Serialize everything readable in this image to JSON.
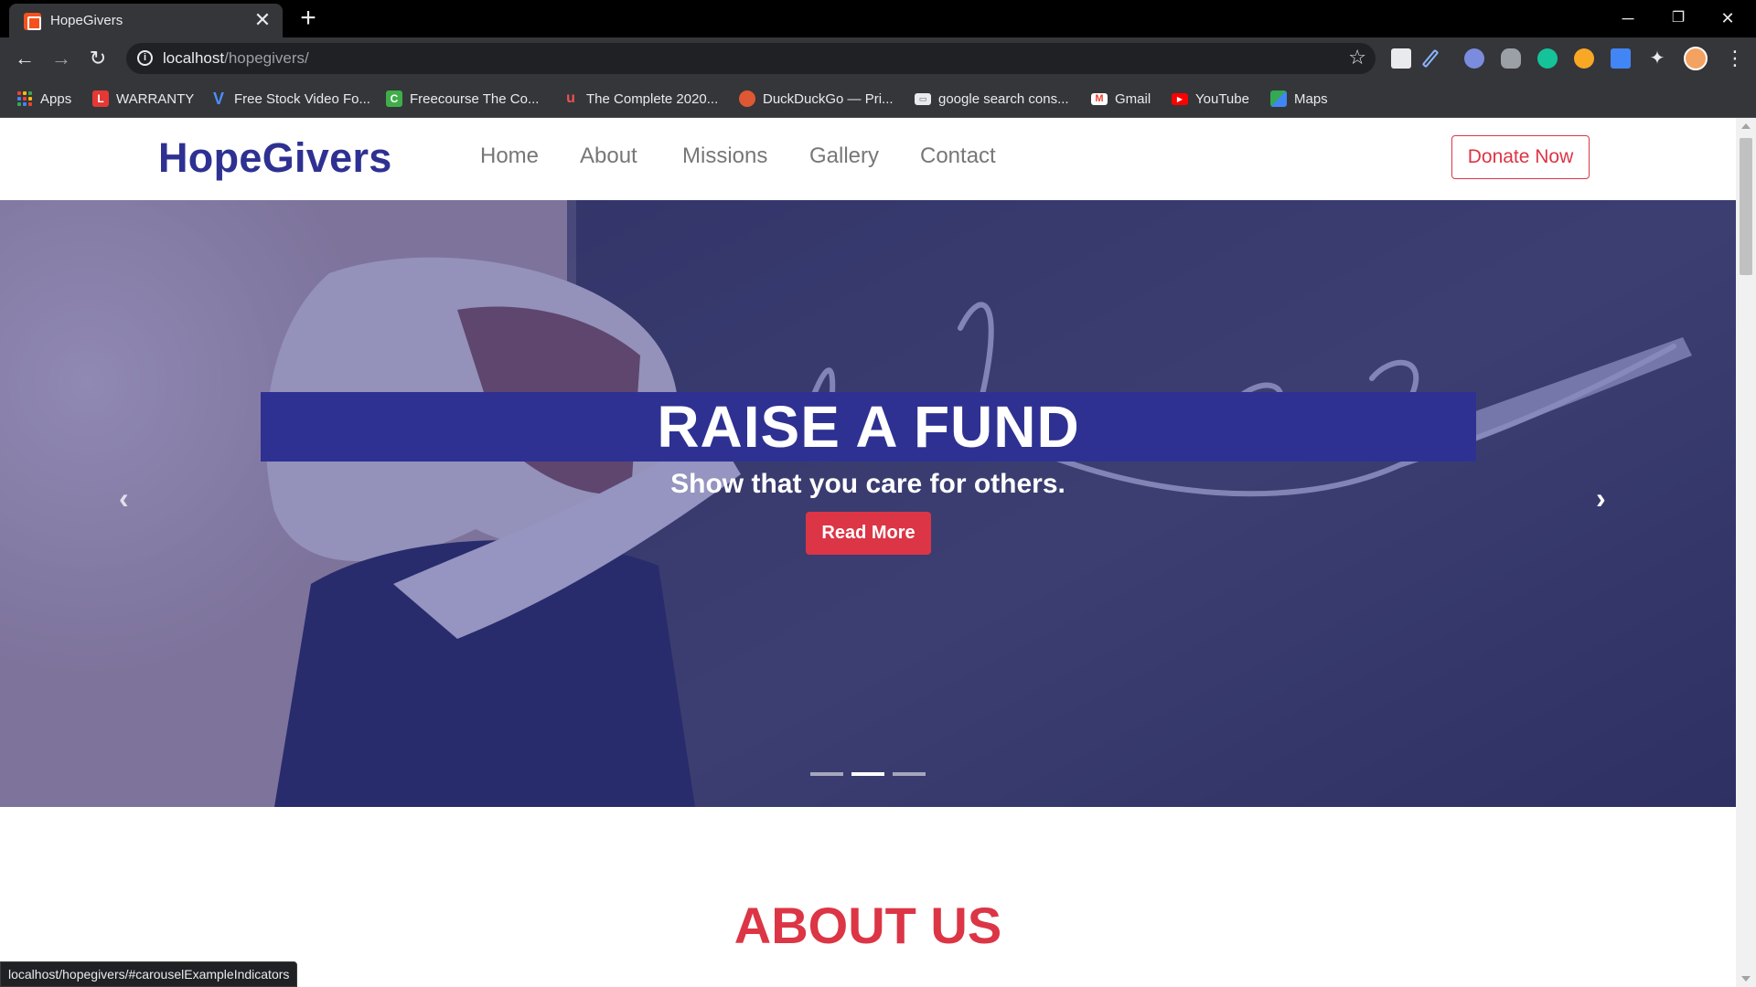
{
  "browser": {
    "tab": {
      "title": "HopeGivers"
    },
    "new_tab_symbol": "+",
    "close_symbol": "✕",
    "window_controls": {
      "minimize": "─",
      "restore": "❐",
      "close": "✕"
    },
    "nav": {
      "back": "←",
      "forward": "→",
      "reload": "↻"
    },
    "address": {
      "host": "localhost",
      "path": "/hopegivers/"
    },
    "bookmarks": [
      {
        "label": "Apps",
        "icon": "apps-grid-icon"
      },
      {
        "label": "WARRANTY",
        "icon": "l-icon",
        "color": "#e53935"
      },
      {
        "label": "Free Stock Video Fo...",
        "icon": "v-icon",
        "color": "#1e63d6"
      },
      {
        "label": "Freecourse The Co...",
        "icon": "freecourse-icon",
        "color": "#3fae49"
      },
      {
        "label": "The Complete 2020...",
        "icon": "udemy-icon",
        "color": "#ec5252"
      },
      {
        "label": "DuckDuckGo — Pri...",
        "icon": "duckduckgo-icon",
        "color": "#de5833"
      },
      {
        "label": "google search cons...",
        "icon": "search-console-icon",
        "color": "#8ab4f8"
      },
      {
        "label": "Gmail",
        "icon": "gmail-icon",
        "color": "#ea4335"
      },
      {
        "label": "YouTube",
        "icon": "youtube-icon",
        "color": "#ff0000"
      },
      {
        "label": "Maps",
        "icon": "maps-icon",
        "color": "#34a853"
      }
    ],
    "status_url": "localhost/hopegivers/#carouselExampleIndicators"
  },
  "site": {
    "brand": "HopeGivers",
    "nav": [
      "Home",
      "About",
      "Missions",
      "Gallery",
      "Contact"
    ],
    "donate_label": "Donate Now",
    "hero": {
      "title": "RAISE A FUND",
      "subtitle": "Show that you care for others.",
      "button_label": "Read More",
      "prev_symbol": "‹",
      "next_symbol": "›",
      "active_indicator": 1
    },
    "about_title": "ABOUT US"
  },
  "colors": {
    "brand": "#2e3192",
    "accent": "#dc3545",
    "nav_link": "#777777"
  }
}
